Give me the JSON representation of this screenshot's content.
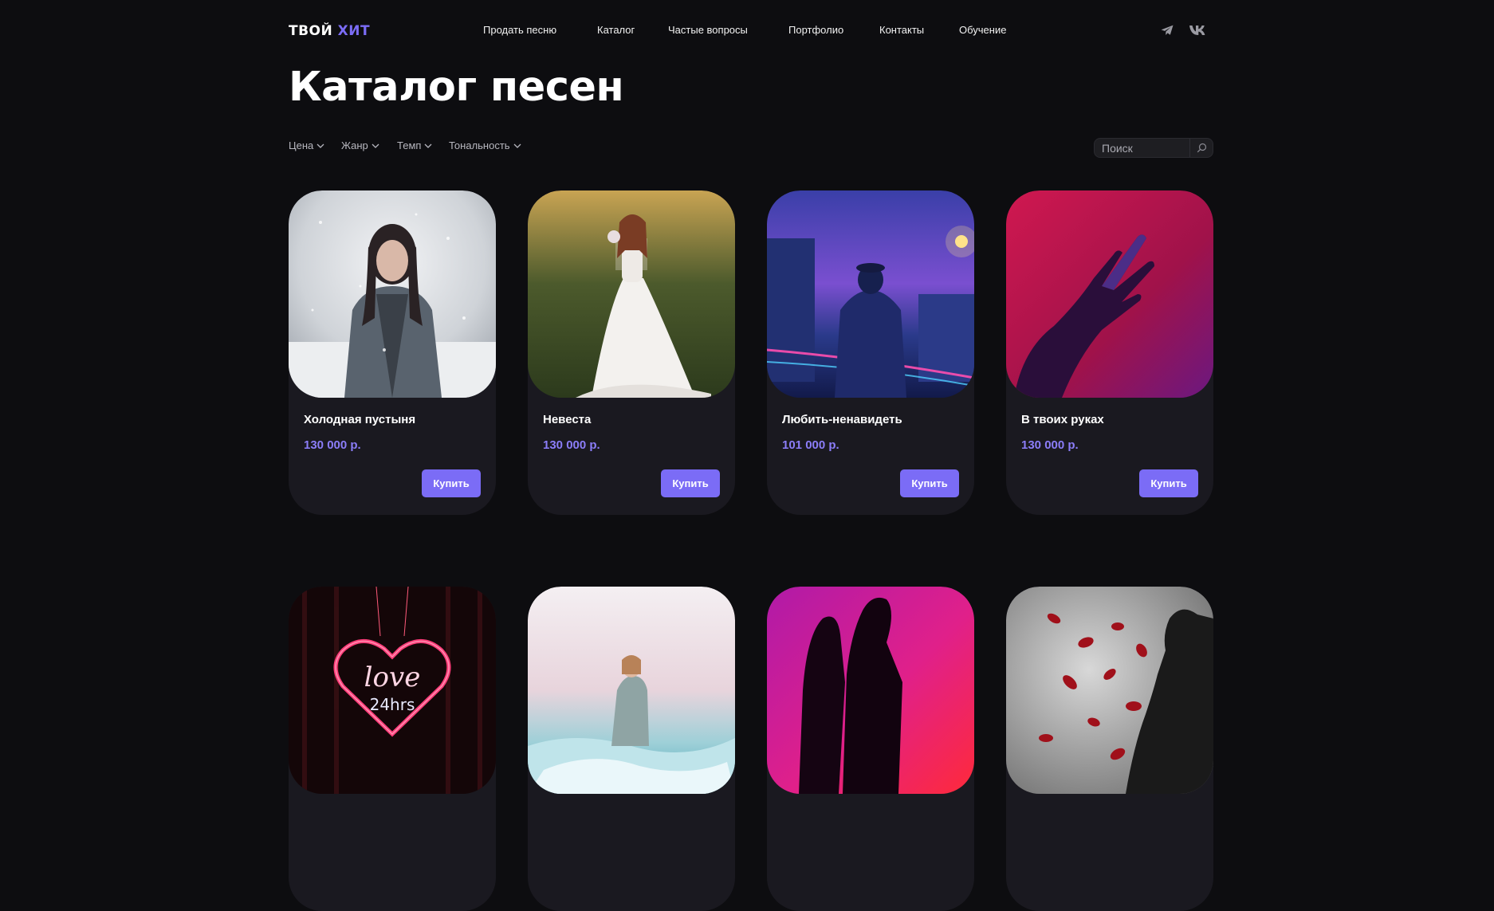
{
  "header": {
    "logo_part1": "ТВОЙ",
    "logo_part2": "ХИТ",
    "nav": [
      "Продать песню",
      "Каталог",
      "Частые вопросы",
      "Портфолио",
      "Контакты",
      "Обучение"
    ]
  },
  "page_title": "Каталог песен",
  "filters": [
    "Цена",
    "Жанр",
    "Темп",
    "Тональность"
  ],
  "search": {
    "placeholder": "Поиск"
  },
  "buy_label": "Купить",
  "songs": [
    {
      "title": "Холодная пустыня",
      "price": "130 000 р."
    },
    {
      "title": "Невеста",
      "price": "130 000 р."
    },
    {
      "title": "Любить-ненавидеть",
      "price": "101 000 р."
    },
    {
      "title": "В твоих руках",
      "price": "130 000 р."
    },
    {
      "title": "",
      "price": ""
    },
    {
      "title": "",
      "price": ""
    },
    {
      "title": "",
      "price": ""
    },
    {
      "title": "",
      "price": ""
    }
  ],
  "icons": {
    "social": [
      "telegram-icon",
      "vk-icon"
    ],
    "search": "search-icon",
    "filter": "chevron-down-icon"
  },
  "colors": {
    "background": "#0d0d10",
    "card": "#1a1920",
    "accent": "#7b6cf6",
    "price": "#8b7df8"
  }
}
